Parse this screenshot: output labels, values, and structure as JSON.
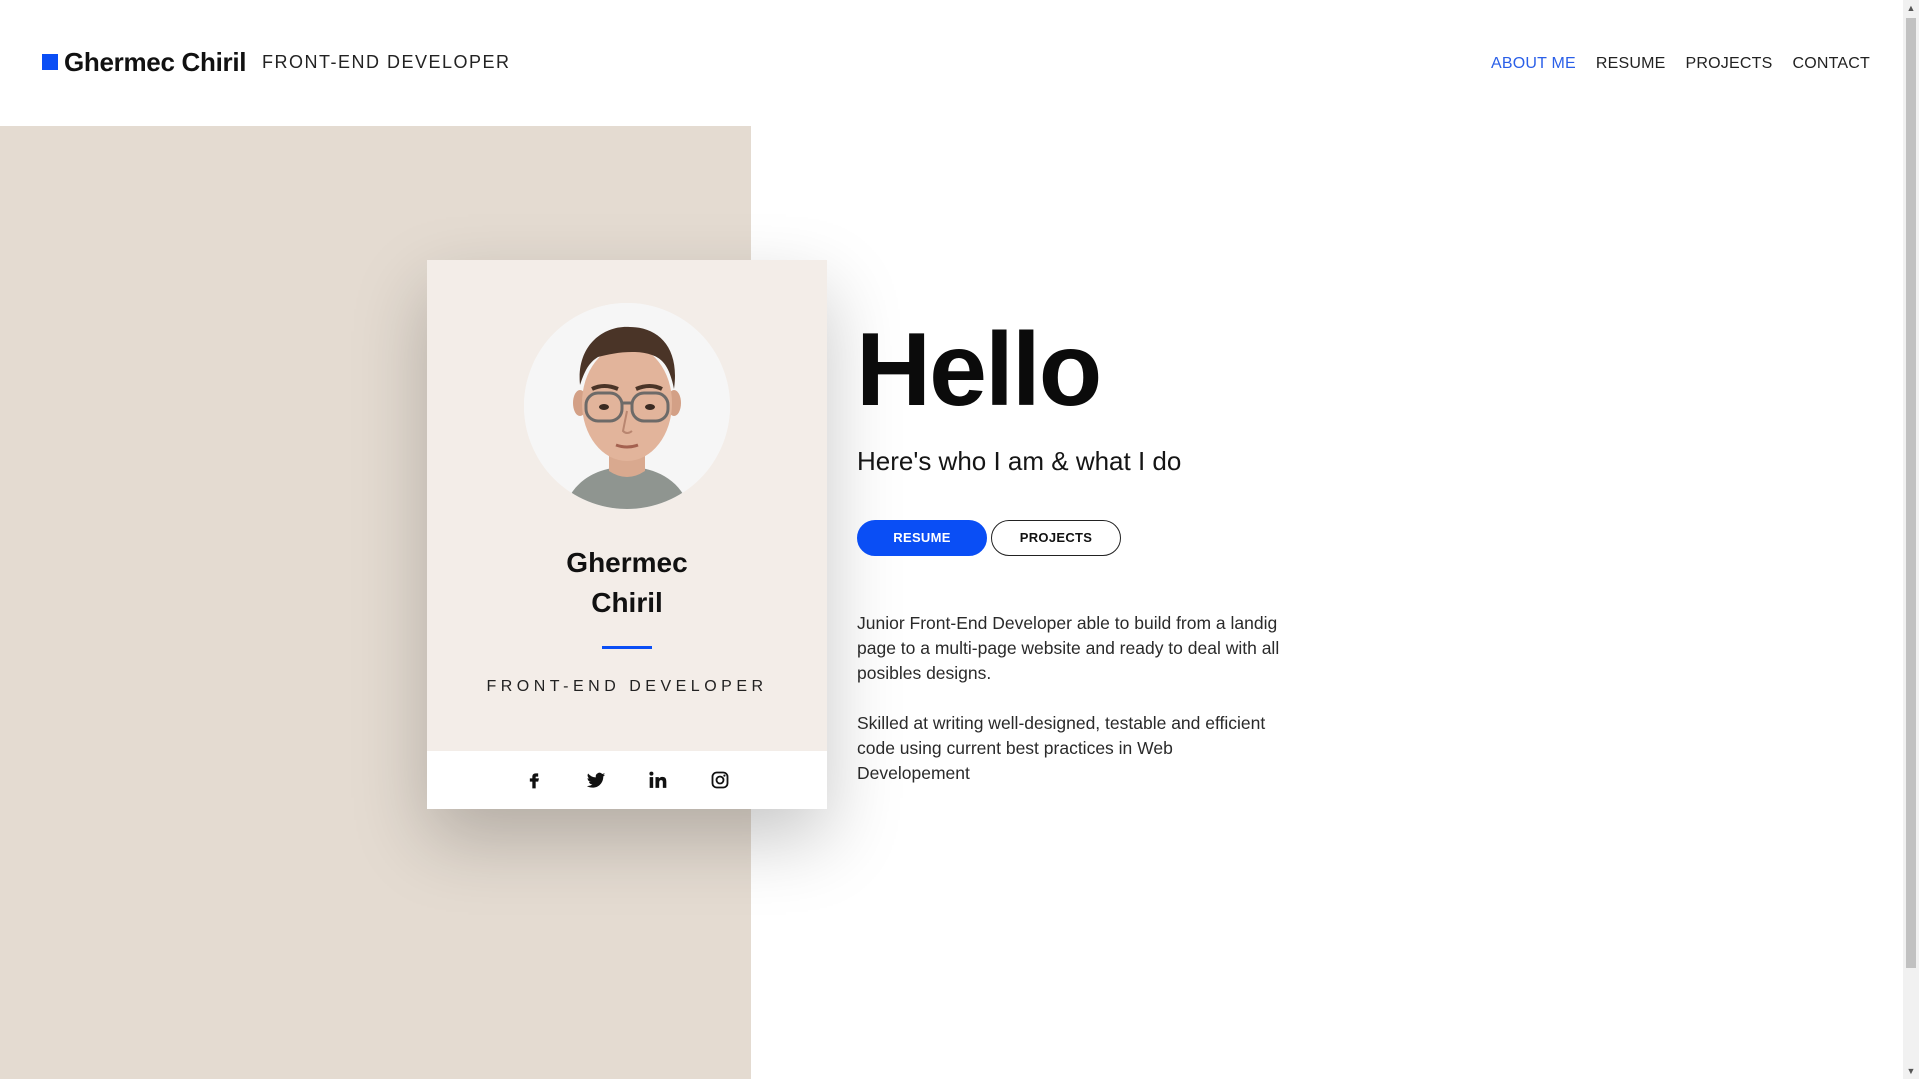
{
  "header": {
    "name": "Ghermec Chiril",
    "role": "FRONT-END DEVELOPER",
    "nav": [
      {
        "label": "ABOUT ME",
        "active": true
      },
      {
        "label": "RESUME",
        "active": false
      },
      {
        "label": "PROJECTS",
        "active": false
      },
      {
        "label": "CONTACT",
        "active": false
      }
    ]
  },
  "card": {
    "first_name": "Ghermec",
    "last_name": "Chiril",
    "role": "FRONT-END DEVELOPER",
    "social": [
      "facebook-icon",
      "twitter-icon",
      "linkedin-icon",
      "instagram-icon"
    ]
  },
  "main": {
    "heading": "Hello",
    "subtitle": "Here's who I am & what I do",
    "resume_button": "RESUME",
    "projects_button": "PROJECTS",
    "paragraph1": "Junior Front-End Developer able to build from a landig page to a multi-page website and ready to deal with all posibles designs.",
    "paragraph2": "Skilled at writing well-designed, testable and efficient code using current best practices in Web Developement"
  },
  "colors": {
    "accent": "#0a4ef5",
    "beige": "#e4dbd1",
    "card": "#f3ede8"
  }
}
